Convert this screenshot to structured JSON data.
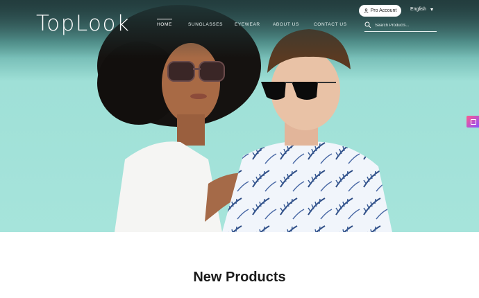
{
  "brand": {
    "logo_text": "TopLook"
  },
  "nav": {
    "items": [
      {
        "label": "HOME",
        "active": true
      },
      {
        "label": "SUNGLASSES",
        "active": false
      },
      {
        "label": "EYEWEAR",
        "active": false
      },
      {
        "label": "ABOUT US",
        "active": false
      },
      {
        "label": "CONTACT US",
        "active": false
      }
    ]
  },
  "header": {
    "pro_account_label": "Pro Account",
    "language_label": "English",
    "search_placeholder": "Search Products..."
  },
  "icons": {
    "user": "user-icon",
    "search": "search-icon",
    "caret": "caret-down-icon",
    "side_badge": "sticky-widget-icon"
  },
  "colors": {
    "hero_top": "#2b4b4c",
    "hero_bg": "#a6e4db",
    "text_dark": "#1b1b1b",
    "badge_gradient": [
      "#ff5b8a",
      "#8a4dff"
    ]
  },
  "sections": {
    "new_products_title": "New Products"
  }
}
